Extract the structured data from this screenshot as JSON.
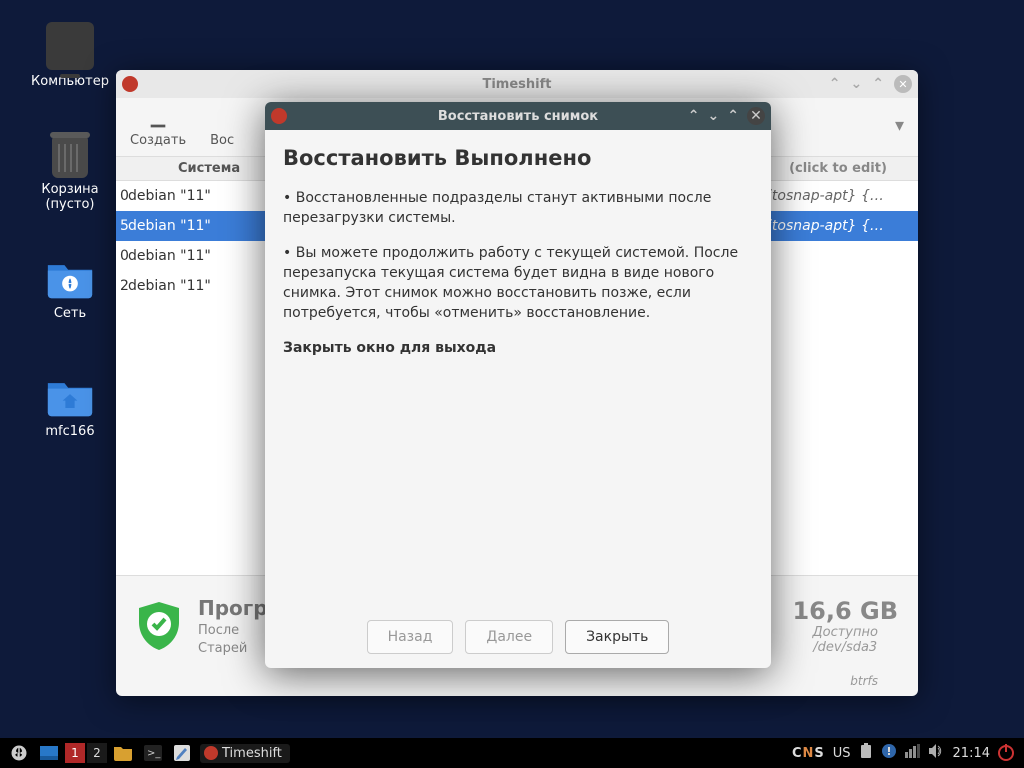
{
  "desktop": {
    "computer": "Компьютер",
    "trash": "Корзина\n(пусто)",
    "network": "Сеть",
    "mfc": "mfc166"
  },
  "window": {
    "title": "Timeshift",
    "toolbar": {
      "create": "Создать",
      "restore": "Вос"
    },
    "table": {
      "hdr_system": "Система",
      "hdr_edit": "(click to edit)",
      "rows": [
        {
          "n": "0",
          "sys": "debian \"11\"",
          "tag": "itosnap-apt} {…",
          "sel": false
        },
        {
          "n": "5",
          "sys": "debian \"11\"",
          "tag": "itosnap-apt} {…",
          "sel": true
        },
        {
          "n": "0",
          "sys": "debian \"11\"",
          "tag": "",
          "sel": false
        },
        {
          "n": "2",
          "sys": "debian \"11\"",
          "tag": "",
          "sel": false
        }
      ]
    },
    "footer": {
      "title": "Прогр",
      "line1": "После",
      "line2": "Старей",
      "size": "16,6 GB",
      "avail": "Доступно",
      "fs": "btrfs",
      "dev": "/dev/sda3"
    }
  },
  "dialog": {
    "title": "Восстановить снимок",
    "heading": "Восстановить Выполнено",
    "p1": "• Восстановленные подразделы станут активными после перезагрузки системы.",
    "p2": "• Вы можете продолжить работу с текущей системой. После перезапуска текущая система будет видна в виде нового снимка. Этот снимок можно восстановить позже, если потребуется, чтобы «отменить» восстановление.",
    "p3": "Закрыть окно для выхода",
    "btn_back": "Назад",
    "btn_next": "Далее",
    "btn_close": "Закрыть"
  },
  "taskbar": {
    "ws": [
      "1",
      "2"
    ],
    "app": "Timeshift",
    "cns": {
      "c": "C",
      "n": "N",
      "s": "S"
    },
    "lang": "US",
    "time": "21:14"
  }
}
